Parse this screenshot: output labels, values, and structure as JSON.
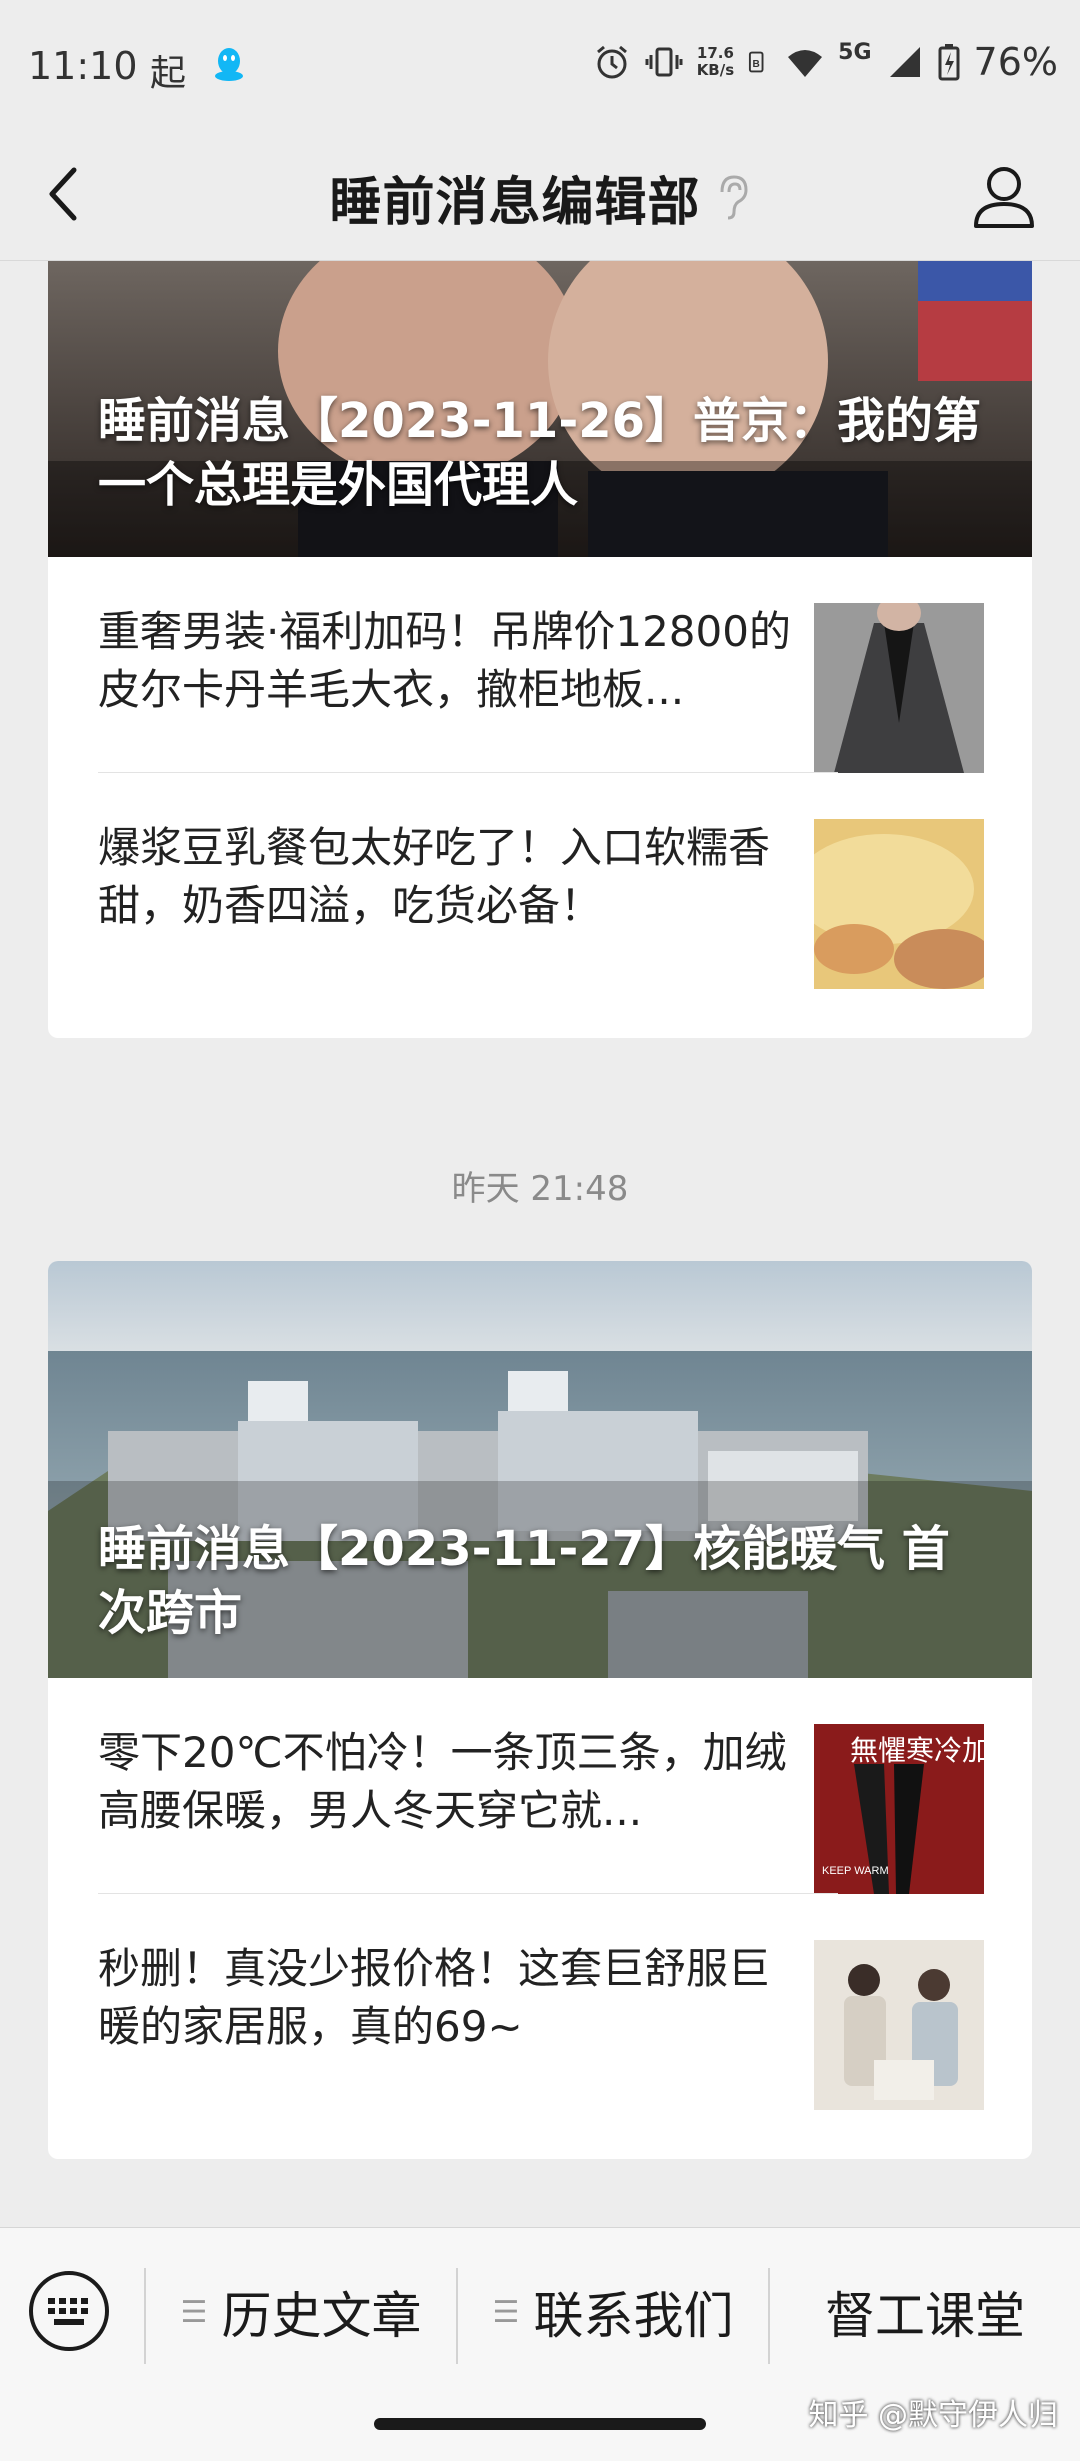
{
  "status_bar": {
    "time": "11:10",
    "extra": "起",
    "net_speed_value": "17.6",
    "net_speed_unit": "KB/s",
    "network": "5G",
    "battery": "76%"
  },
  "nav": {
    "title": "睡前消息编辑部"
  },
  "articles": [
    {
      "cover_title": "睡前消息【2023-11-26】普京：我的第一个总理是外国代理人",
      "items": [
        {
          "text": "重奢男装·福利加码！吊牌价12800的皮尔卡丹羊毛大衣，撤柜地板..."
        },
        {
          "text": "爆浆豆乳餐包太好吃了！入口软糯香甜，奶香四溢，吃货必备！"
        }
      ]
    },
    {
      "timestamp": "昨天 21:48",
      "cover_title": "睡前消息【2023-11-27】核能暖气 首次跨市",
      "items": [
        {
          "text": "零下20℃不怕冷！一条顶三条，加绒高腰保暖，男人冬天穿它就..."
        },
        {
          "text": "秒删！真没少报价格！这套巨舒服巨暖的家居服，真的69~"
        }
      ],
      "thumb_text": {
        "main": "無懼寒冷加絨",
        "sub": "KEEP WARM"
      }
    }
  ],
  "bottom_menu": {
    "items": [
      {
        "label": "历史文章"
      },
      {
        "label": "联系我们"
      },
      {
        "label": "督工课堂"
      }
    ]
  },
  "watermark": "知乎 @默守伊人归",
  "colors": {
    "background": "#ededed",
    "card": "#ffffff",
    "text_primary": "#191919",
    "text_secondary": "#8a8a8a",
    "qq_blue": "#12b7f5"
  }
}
